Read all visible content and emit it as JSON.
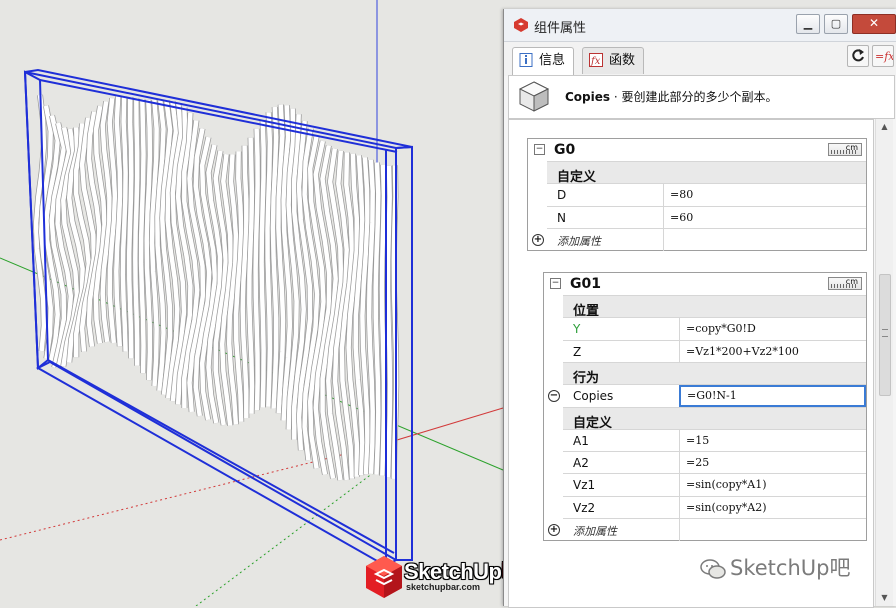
{
  "dialog": {
    "title": "组件属性",
    "tabs": [
      {
        "label": "信息",
        "icon": "info-icon",
        "active": true
      },
      {
        "label": "函数",
        "icon": "function-icon",
        "active": false
      }
    ],
    "info_name": "Copies",
    "info_text": " · 要创建此部分的多少个副本。"
  },
  "entities": [
    {
      "name": "G0",
      "unit": "cm",
      "rows": [
        {
          "type": "section",
          "label": "自定义"
        },
        {
          "type": "attr",
          "label": "D",
          "value": "=80"
        },
        {
          "type": "attr",
          "label": "N",
          "value": "=60"
        },
        {
          "type": "add",
          "label": "添加属性"
        }
      ]
    },
    {
      "name": "G01",
      "unit": "cm",
      "rows": [
        {
          "type": "section",
          "label": "位置"
        },
        {
          "type": "attr",
          "label": "Y",
          "value": "=copy*G0!D",
          "color": "#2c9e3a"
        },
        {
          "type": "attr",
          "label": "Z",
          "value": "=Vz1*200+Vz2*100"
        },
        {
          "type": "section",
          "label": "行为"
        },
        {
          "type": "attr",
          "label": "Copies",
          "value": "=G0!N-1",
          "editing": true
        },
        {
          "type": "section",
          "label": "自定义"
        },
        {
          "type": "attr",
          "label": "A1",
          "value": "=15"
        },
        {
          "type": "attr",
          "label": "A2",
          "value": "=25"
        },
        {
          "type": "attr",
          "label": "Vz1",
          "value": "=sin(copy*A1)"
        },
        {
          "type": "attr",
          "label": "Vz2",
          "value": "=sin(copy*A2)"
        },
        {
          "type": "add",
          "label": "添加属性"
        }
      ]
    }
  ],
  "watermark": "SketchUp吧",
  "logo": {
    "brand_main": "SketchUp",
    "brand_suffix": "吧",
    "site": "sketchupbar.com"
  },
  "colors": {
    "selection_blue": "#1f2fd8",
    "axis_green": "#2da22d",
    "axis_red": "#d23a3a"
  }
}
